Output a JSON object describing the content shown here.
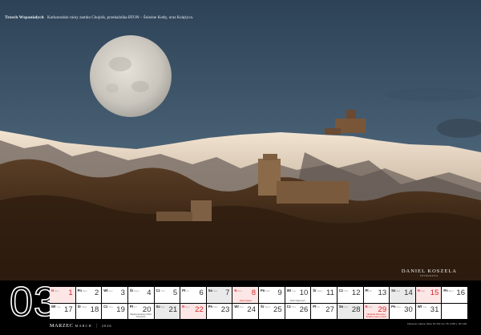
{
  "photo": {
    "caption_title": "Trzech Wspaniałych",
    "caption_text": "Karkonoskie ruiny zamku Chojnik, przekaźnika RTON – Śnieżne Kotły, oraz Księżyca.",
    "credit_name": "DANIEL KOSZELA",
    "credit_sub": "FOTOGRAFIA"
  },
  "month": {
    "number": "03",
    "name": "MARZEC",
    "name_alt": "MARCH",
    "year": "2026"
  },
  "colors": {
    "sunday": "#d42a2a",
    "saturday_cell": "#eaeaea",
    "sunday_cell": "#fde6e6"
  },
  "days": [
    {
      "day": "1",
      "wd": "N",
      "wd_sub": "Sun",
      "type": "sun",
      "note": ""
    },
    {
      "day": "2",
      "wd": "Pn",
      "wd_sub": "Mon",
      "type": "",
      "note": ""
    },
    {
      "day": "3",
      "wd": "Wt",
      "wd_sub": "Tue",
      "type": "",
      "note": ""
    },
    {
      "day": "4",
      "wd": "Śr",
      "wd_sub": "Wed",
      "type": "",
      "note": ""
    },
    {
      "day": "5",
      "wd": "Cz",
      "wd_sub": "Thu",
      "type": "",
      "note": ""
    },
    {
      "day": "6",
      "wd": "Pt",
      "wd_sub": "Fri",
      "type": "",
      "note": ""
    },
    {
      "day": "7",
      "wd": "So",
      "wd_sub": "Sat",
      "type": "sat",
      "note": ""
    },
    {
      "day": "8",
      "wd": "N",
      "wd_sub": "Sun",
      "type": "sun",
      "note": "Dzień Kobiet"
    },
    {
      "day": "9",
      "wd": "Pn",
      "wd_sub": "Mon",
      "type": "",
      "note": ""
    },
    {
      "day": "10",
      "wd": "Wt",
      "wd_sub": "Tue",
      "type": "",
      "note": "Dzień Mężczyzn"
    },
    {
      "day": "11",
      "wd": "Śr",
      "wd_sub": "Wed",
      "type": "",
      "note": ""
    },
    {
      "day": "12",
      "wd": "Cz",
      "wd_sub": "Thu",
      "type": "",
      "note": ""
    },
    {
      "day": "13",
      "wd": "Pt",
      "wd_sub": "Fri",
      "type": "",
      "note": ""
    },
    {
      "day": "14",
      "wd": "So",
      "wd_sub": "Sat",
      "type": "sat",
      "note": ""
    },
    {
      "day": "15",
      "wd": "N",
      "wd_sub": "Sun",
      "type": "sun",
      "note": ""
    },
    {
      "day": "16",
      "wd": "Pn",
      "wd_sub": "Mon",
      "type": "",
      "note": ""
    },
    {
      "day": "17",
      "wd": "Wt",
      "wd_sub": "Tue",
      "type": "",
      "note": ""
    },
    {
      "day": "18",
      "wd": "Śr",
      "wd_sub": "Wed",
      "type": "",
      "note": ""
    },
    {
      "day": "19",
      "wd": "Cz",
      "wd_sub": "Thu",
      "type": "",
      "note": ""
    },
    {
      "day": "20",
      "wd": "Pt",
      "wd_sub": "Fri",
      "type": "",
      "note": "Międzynarodowy Dzień Szczęścia"
    },
    {
      "day": "21",
      "wd": "So",
      "wd_sub": "Sat",
      "type": "sat",
      "note": ""
    },
    {
      "day": "22",
      "wd": "N",
      "wd_sub": "Sun",
      "type": "sun",
      "note": ""
    },
    {
      "day": "23",
      "wd": "Pn",
      "wd_sub": "Mon",
      "type": "",
      "note": ""
    },
    {
      "day": "24",
      "wd": "Wt",
      "wd_sub": "Tue",
      "type": "",
      "note": ""
    },
    {
      "day": "25",
      "wd": "Śr",
      "wd_sub": "Wed",
      "type": "",
      "note": ""
    },
    {
      "day": "26",
      "wd": "Cz",
      "wd_sub": "Thu",
      "type": "",
      "note": ""
    },
    {
      "day": "27",
      "wd": "Pt",
      "wd_sub": "Fri",
      "type": "",
      "note": ""
    },
    {
      "day": "28",
      "wd": "So",
      "wd_sub": "Sat",
      "type": "sat",
      "note": ""
    },
    {
      "day": "29",
      "wd": "N",
      "wd_sub": "Sun",
      "type": "sun",
      "note": "Niedziela Palmowa / Zmiana czasu na letni"
    },
    {
      "day": "30",
      "wd": "Pn",
      "wd_sub": "Mon",
      "type": "",
      "note": ""
    },
    {
      "day": "31",
      "wd": "Wt",
      "wd_sub": "Tue",
      "type": "",
      "note": ""
    },
    {
      "day": "",
      "wd": "",
      "wd_sub": "",
      "type": "empty",
      "note": ""
    }
  ],
  "footnote": "Parametry zdjęcia: Nikon Z6, 600 mm, f/8, 1/250 s, ISO 400"
}
